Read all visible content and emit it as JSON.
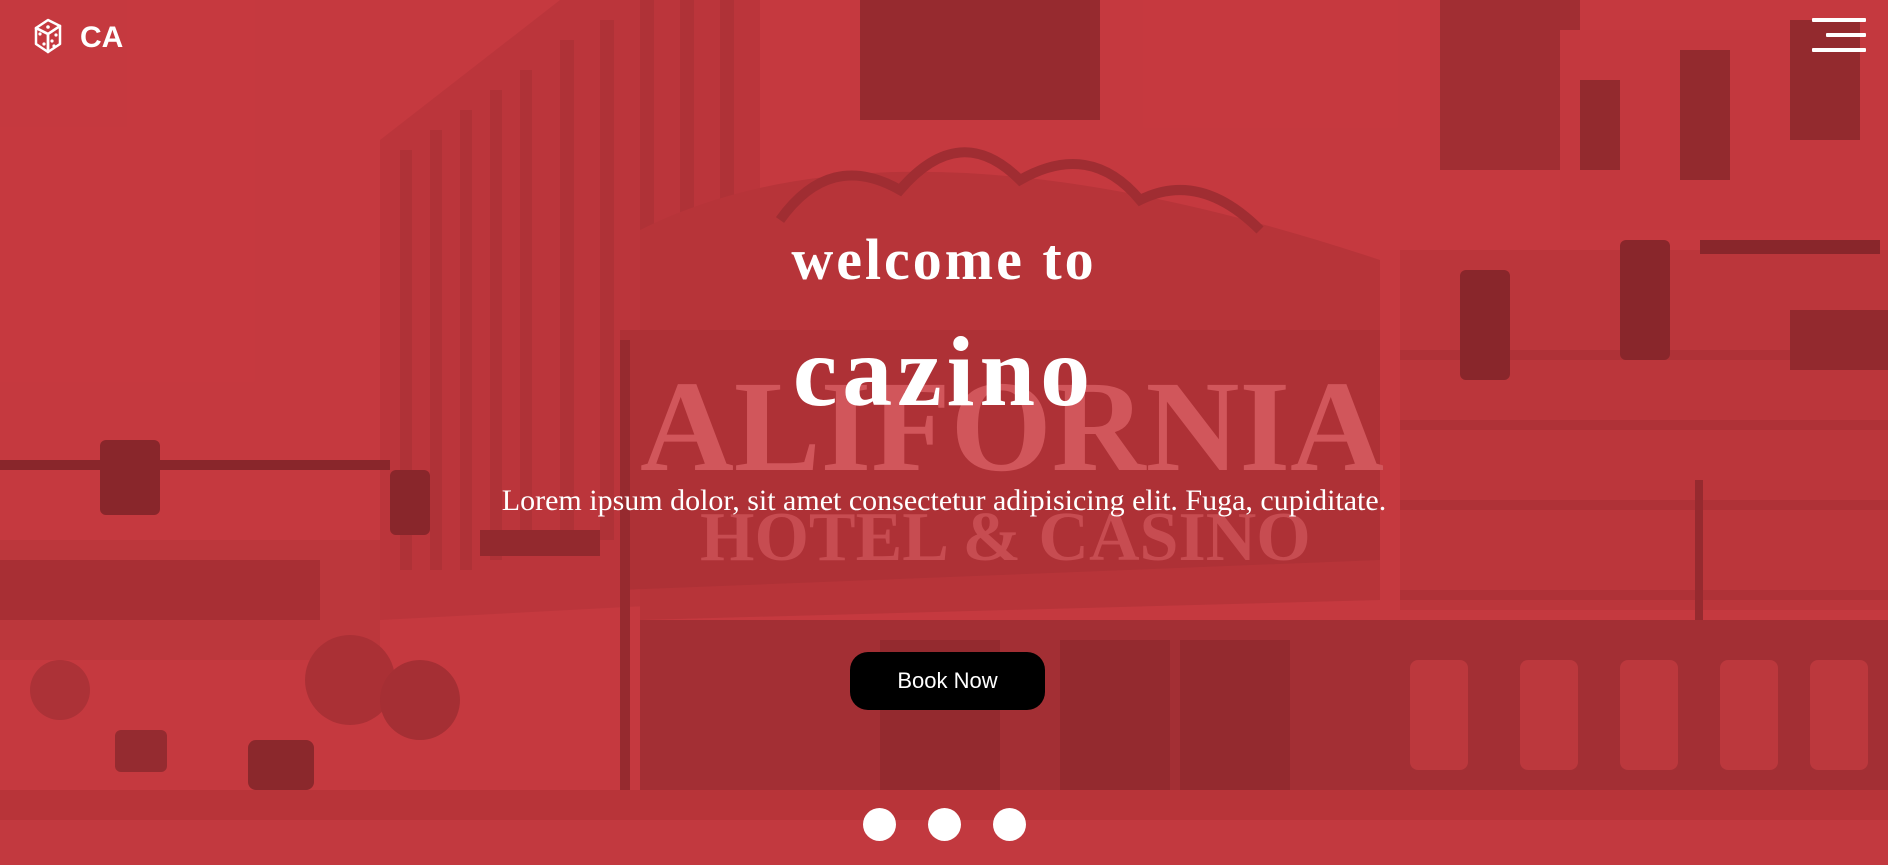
{
  "header": {
    "logo_text": "CA",
    "logo_icon": "dice-icon",
    "menu_icon": "hamburger-menu-icon"
  },
  "hero": {
    "welcome": "welcome to",
    "brand": "cazino",
    "tagline": "Lorem ipsum dolor, sit amet consectetur adipisicing elit. Fuga, cupiditate.",
    "cta_label": "Book Now"
  },
  "carousel": {
    "slide_count": 3
  },
  "colors": {
    "tint": "#c4383e",
    "text": "#ffffff",
    "button_bg": "#000000"
  }
}
